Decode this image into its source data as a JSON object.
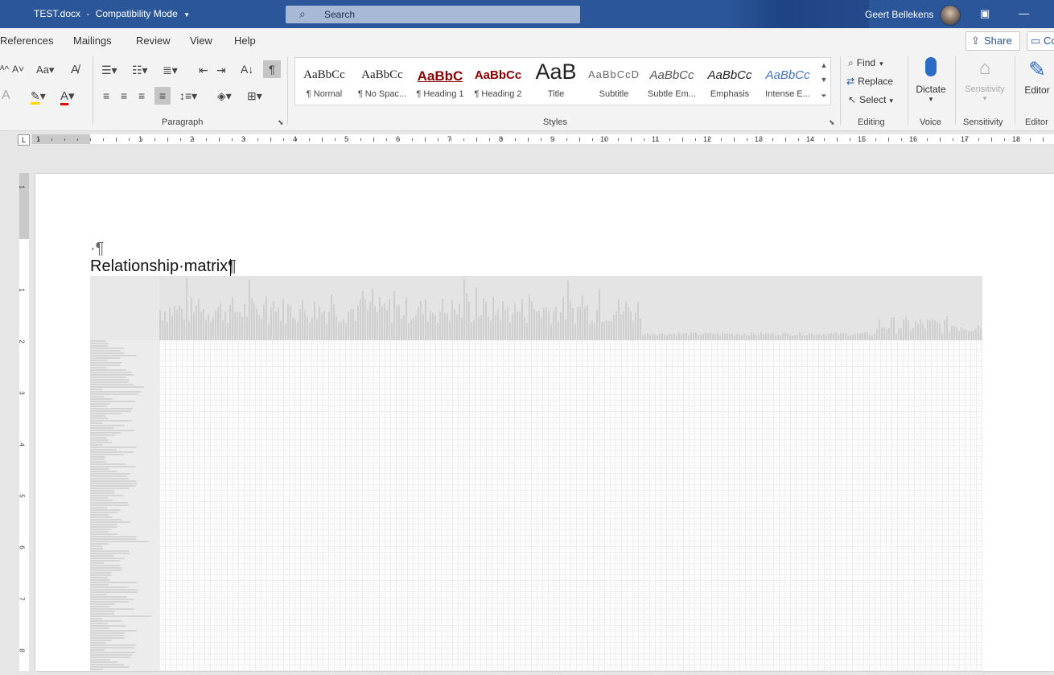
{
  "titlebar": {
    "document": "TEST.docx",
    "separator": "-",
    "mode": "Compatibility Mode",
    "search_placeholder": "Search",
    "user": "Geert Bellekens"
  },
  "menu": {
    "tabs": [
      "References",
      "Mailings",
      "Review",
      "View",
      "Help"
    ],
    "share": "Share",
    "comments": "Co"
  },
  "ribbon": {
    "paragraph_label": "Paragraph",
    "styles_label": "Styles",
    "editing_label": "Editing",
    "voice_label": "Voice",
    "sensitivity_label": "Sensitivity",
    "editor_label": "Editor",
    "styles": [
      {
        "sample": "AaBbCc",
        "name": "¶ Normal"
      },
      {
        "sample": "AaBbCc",
        "name": "¶ No Spac..."
      },
      {
        "sample": "AaBbC",
        "name": "¶ Heading 1"
      },
      {
        "sample": "AaBbCc",
        "name": "¶ Heading 2"
      },
      {
        "sample": "AaB",
        "name": "Title"
      },
      {
        "sample": "AaBbCcD",
        "name": "Subtitle"
      },
      {
        "sample": "AaBbCc",
        "name": "Subtle Em..."
      },
      {
        "sample": "AaBbCc",
        "name": "Emphasis"
      },
      {
        "sample": "AaBbCc",
        "name": "Intense E..."
      }
    ],
    "editing": {
      "find": "Find",
      "replace": "Replace",
      "select": "Select"
    },
    "dictate": "Dictate",
    "sensitivity": "Sensitivity",
    "editor": "Editor"
  },
  "ruler": {
    "numbers": [
      "1",
      "1",
      "2",
      "3",
      "4",
      "5",
      "6",
      "7",
      "8",
      "9",
      "10",
      "11",
      "12",
      "13",
      "14",
      "15",
      "16",
      "17",
      "18"
    ]
  },
  "vruler": {
    "numbers": [
      "1",
      "1",
      "2",
      "3",
      "4",
      "5",
      "6",
      "7",
      "8"
    ]
  },
  "document": {
    "para_mark": "·¶",
    "heading": "Relationship·matrix",
    "heading_mark": "¶"
  },
  "colors": {
    "titlebar": "#2b579a",
    "heading1": "#8b0000",
    "intense": "#4472c4"
  }
}
